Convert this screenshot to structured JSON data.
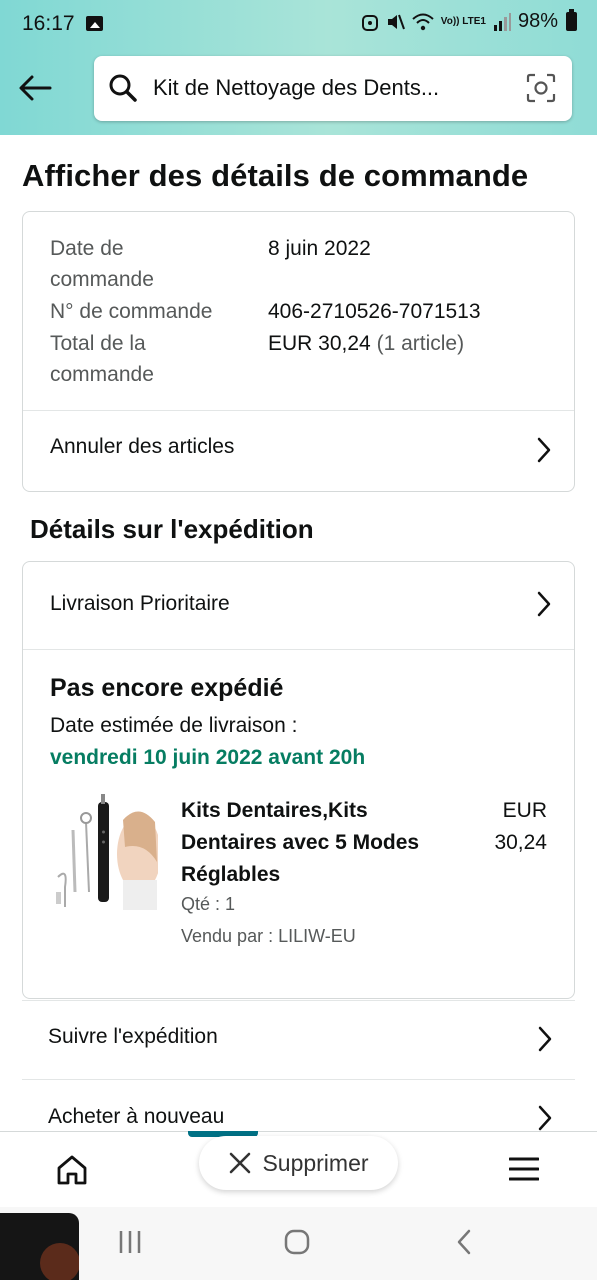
{
  "status_bar": {
    "time": "16:17",
    "network_label": "Vo)) LTE1",
    "battery": "98%"
  },
  "search": {
    "query": "Kit de Nettoyage des Dents..."
  },
  "page": {
    "title": "Afficher des détails de commande"
  },
  "order_summary": {
    "date_label_line1": "Date de",
    "date_label_line2": "commande",
    "date_value": "8 juin 2022",
    "number_label": "N° de commande",
    "number_value": "406-2710526-7071513",
    "total_label_line1": "Total de la",
    "total_label_line2": "commande",
    "total_value": "EUR 30,24",
    "total_count": "(1 article)",
    "cancel_label": "Annuler des articles"
  },
  "shipping": {
    "section_title": "Détails sur l'expédition",
    "method": "Livraison Prioritaire",
    "status": "Pas encore expédié",
    "estimate_label": "Date estimée de livraison :",
    "estimate_date": "vendredi 10 juin 2022 avant 20h",
    "product": {
      "title": "Kits Dentaires,Kits Dentaires avec 5 Modes Réglables",
      "price_currency": "EUR",
      "price_amount": "30,24",
      "quantity": "Qté : 1",
      "seller": "Vendu par : LILIW-EU"
    }
  },
  "actions": {
    "track": "Suivre l'expédition",
    "buy_again": "Acheter à nouveau"
  },
  "bottom_nav": {
    "delete_label": "Supprimer"
  },
  "colors": {
    "header_gradient_start": "#80d8d4",
    "header_gradient_end": "#8fdcd6",
    "delivery_green": "#067d62",
    "nav_accent": "#007185"
  }
}
